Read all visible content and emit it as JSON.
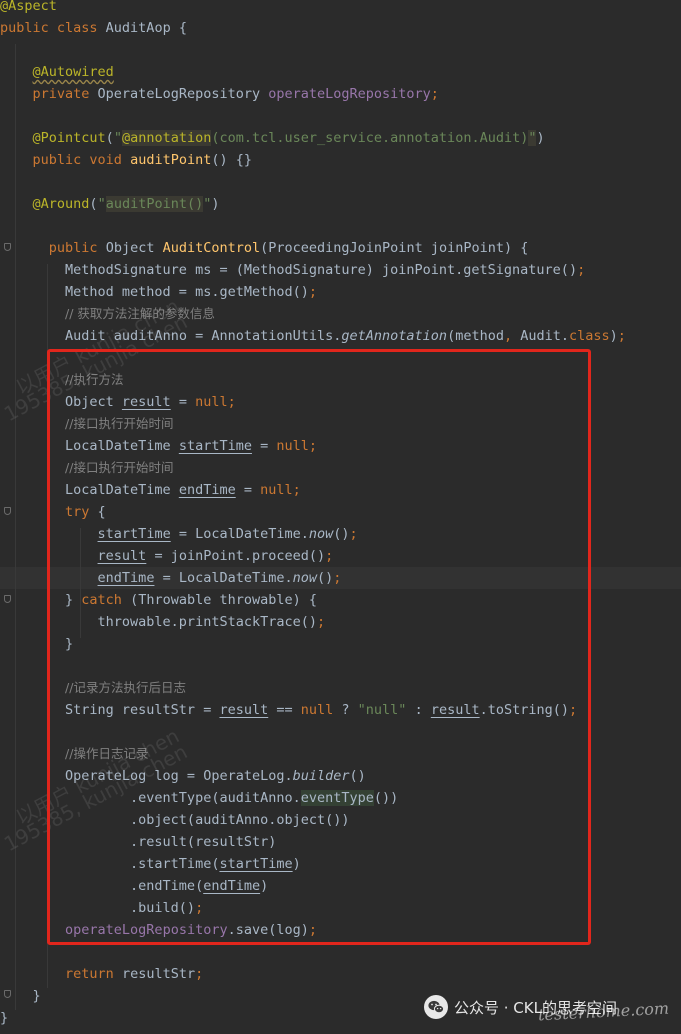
{
  "code_lines": [
    [
      [
        "an",
        "@Aspect"
      ]
    ],
    [
      [
        "k",
        "public class "
      ],
      [
        "",
        "AuditAop {"
      ]
    ],
    [],
    [
      [
        "",
        "    "
      ],
      [
        "an wv",
        "@Autowired"
      ]
    ],
    [
      [
        "",
        "    "
      ],
      [
        "k",
        "private "
      ],
      [
        "",
        "OperateLogRepository "
      ],
      [
        "fld",
        "operateLogRepository"
      ],
      [
        "k",
        ";"
      ]
    ],
    [],
    [
      [
        "",
        "    "
      ],
      [
        "an",
        "@Pointcut"
      ],
      [
        "",
        "("
      ],
      [
        "str",
        "\""
      ],
      [
        "an hl2",
        "@annotation"
      ],
      [
        "str",
        "(com.tcl.user_service.annotation.Audit)"
      ],
      [
        "str hl2",
        "\""
      ],
      [
        "",
        ")"
      ]
    ],
    [
      [
        "",
        "    "
      ],
      [
        "k",
        "public void "
      ],
      [
        "fn",
        "auditPoint"
      ],
      [
        "",
        "() {}"
      ]
    ],
    [],
    [
      [
        "",
        "    "
      ],
      [
        "an",
        "@Around"
      ],
      [
        "",
        "("
      ],
      [
        "str",
        "\""
      ],
      [
        "str hl2",
        "auditPoint()"
      ],
      [
        "str",
        "\""
      ],
      [
        "",
        ")"
      ]
    ],
    [],
    [
      [
        "",
        "      "
      ],
      [
        "k",
        "public "
      ],
      [
        "",
        "Object "
      ],
      [
        "fn",
        "AuditControl"
      ],
      [
        "",
        "(ProceedingJoinPoint joinPoint) {"
      ]
    ],
    [
      [
        "",
        "        MethodSignature ms = (MethodSignature) joinPoint.getSignature()"
      ],
      [
        "k",
        ";"
      ]
    ],
    [
      [
        "",
        "        Method method = ms.getMethod()"
      ],
      [
        "k",
        ";"
      ]
    ],
    [
      [
        "",
        "        "
      ],
      [
        "cm",
        "// 获取方法注解的参数信息"
      ]
    ],
    [
      [
        "",
        "        Audit "
      ],
      [
        "",
        "auditAnno"
      ],
      [
        "",
        " = AnnotationUtils."
      ],
      [
        "st",
        "getAnnotation"
      ],
      [
        "",
        "(method"
      ],
      [
        "k",
        ", "
      ],
      [
        "",
        "Audit."
      ],
      [
        "k",
        "class"
      ],
      [
        "",
        ")"
      ],
      [
        "k",
        ";"
      ]
    ],
    [],
    [
      [
        "",
        "        "
      ],
      [
        "cm",
        "//执行方法"
      ]
    ],
    [
      [
        "",
        "        Object "
      ],
      [
        "ul",
        "result"
      ],
      [
        "",
        " = "
      ],
      [
        "k",
        "null;"
      ]
    ],
    [
      [
        "",
        "        "
      ],
      [
        "cm",
        "//接口执行开始时间"
      ]
    ],
    [
      [
        "",
        "        LocalDateTime "
      ],
      [
        "ul",
        "startTime"
      ],
      [
        "",
        " = "
      ],
      [
        "k",
        "null;"
      ]
    ],
    [
      [
        "",
        "        "
      ],
      [
        "cm",
        "//接口执行开始时间"
      ]
    ],
    [
      [
        "",
        "        LocalDateTime "
      ],
      [
        "ul",
        "endTime"
      ],
      [
        "",
        " = "
      ],
      [
        "k",
        "null;"
      ]
    ],
    [
      [
        "",
        "        "
      ],
      [
        "k",
        "try "
      ],
      [
        "",
        "{"
      ]
    ],
    [
      [
        "",
        "            "
      ],
      [
        "ul",
        "startTime"
      ],
      [
        "",
        " = LocalDateTime."
      ],
      [
        "st",
        "now"
      ],
      [
        "",
        "()"
      ],
      [
        "k",
        ";"
      ]
    ],
    [
      [
        "",
        "            "
      ],
      [
        "ul",
        "result"
      ],
      [
        "",
        " = joinPoint.proceed()"
      ],
      [
        "k",
        ";"
      ]
    ],
    [
      [
        "",
        "            "
      ],
      [
        "ul",
        "endTime"
      ],
      [
        "",
        " = LocalDateTime."
      ],
      [
        "st",
        "now"
      ],
      [
        "",
        "()"
      ],
      [
        "k",
        ";"
      ]
    ],
    [
      [
        "",
        "        } "
      ],
      [
        "k",
        "catch "
      ],
      [
        "",
        "(Throwable throwable) {"
      ]
    ],
    [
      [
        "",
        "            throwable.printStackTrace()"
      ],
      [
        "k",
        ";"
      ]
    ],
    [
      [
        "",
        "        }"
      ]
    ],
    [],
    [
      [
        "",
        "        "
      ],
      [
        "cm",
        "//记录方法执行后日志"
      ]
    ],
    [
      [
        "",
        "        String resultStr = "
      ],
      [
        "ul",
        "result"
      ],
      [
        "",
        " == "
      ],
      [
        "k",
        "null "
      ],
      [
        "",
        "? "
      ],
      [
        "str",
        "\"null\""
      ],
      [
        "",
        " : "
      ],
      [
        "ul",
        "result"
      ],
      [
        "",
        ".toString()"
      ],
      [
        "k",
        ";"
      ]
    ],
    [],
    [
      [
        "",
        "        "
      ],
      [
        "cm",
        "//操作日志记录"
      ]
    ],
    [
      [
        "",
        "        OperateLog log = OperateLog."
      ],
      [
        "st",
        "builder"
      ],
      [
        "",
        "()"
      ]
    ],
    [
      [
        "",
        "                .eventType(auditAnno."
      ],
      [
        "hl",
        "eventType"
      ],
      [
        "",
        "())"
      ]
    ],
    [
      [
        "",
        "                .object(auditAnno.object())"
      ]
    ],
    [
      [
        "",
        "                .result(resultStr)"
      ]
    ],
    [
      [
        "",
        "                .startTime("
      ],
      [
        "ul",
        "startTime"
      ],
      [
        "",
        ")"
      ]
    ],
    [
      [
        "",
        "                .endTime("
      ],
      [
        "ul",
        "endTime"
      ],
      [
        "",
        ")"
      ]
    ],
    [
      [
        "",
        "                .build()"
      ],
      [
        "k",
        ";"
      ]
    ],
    [
      [
        "",
        "        "
      ],
      [
        "fld",
        "operateLogRepository"
      ],
      [
        "",
        ".save(log)"
      ],
      [
        "k",
        ";"
      ]
    ],
    [],
    [
      [
        "",
        "        "
      ],
      [
        "k",
        "return "
      ],
      [
        "",
        "resultStr"
      ],
      [
        "k",
        ";"
      ]
    ],
    [
      [
        "",
        "    }"
      ]
    ],
    [
      [
        "",
        "}"
      ]
    ]
  ],
  "watermarks": [
    "以用户 kunjia chen",
    "195385, kunjia chen",
    "以用户 kunjia chen",
    "195385, kunjia chen"
  ],
  "footer": {
    "brand_text": "公众号 · CKL的思考空间",
    "site_mark": "testerhome.com"
  },
  "icons": {
    "wechat": "wechat-icon",
    "fold": "fold-marker-icon"
  },
  "colors": {
    "background": "#2b2b2b",
    "keyword": "#cc7832",
    "annotation": "#bbb529",
    "string": "#6a8759",
    "highlight_border": "#e1261c"
  }
}
